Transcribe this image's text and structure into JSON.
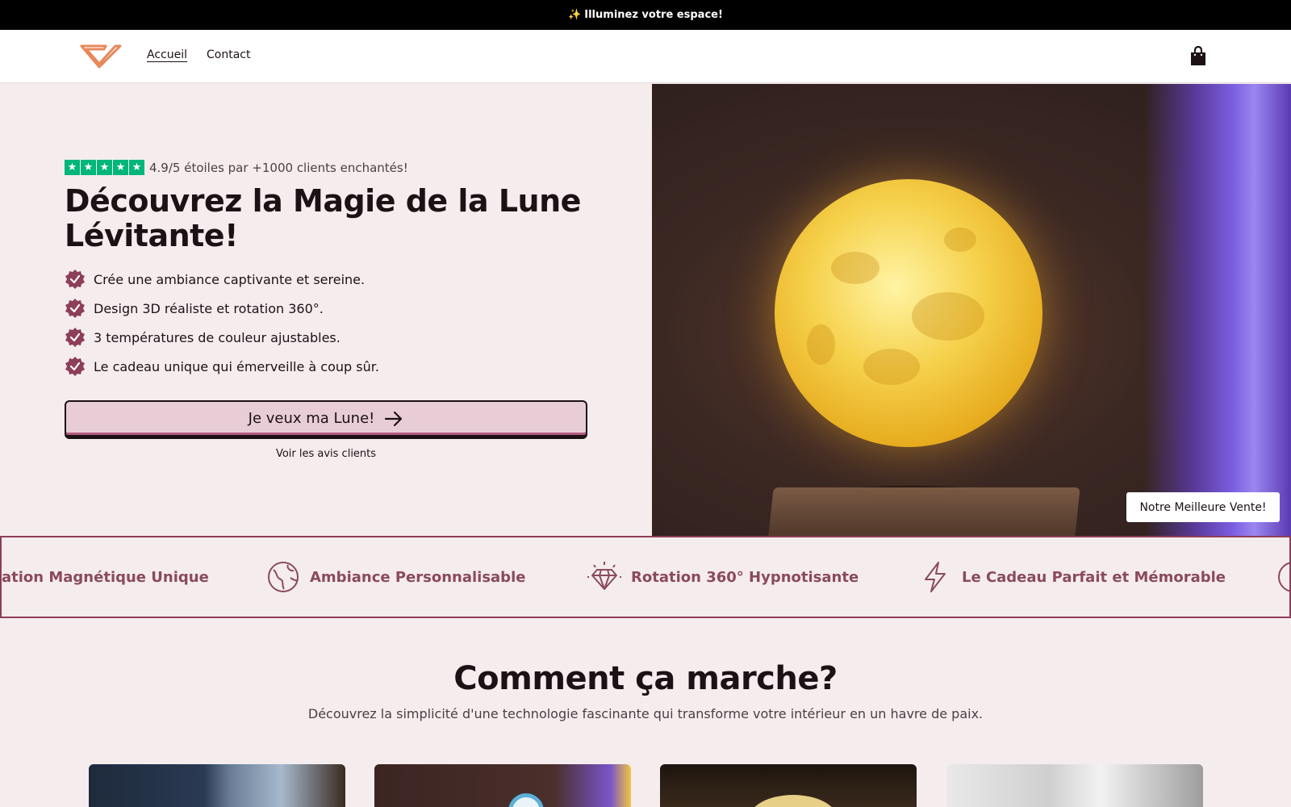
{
  "announcement": {
    "icon": "sparkles-icon",
    "text": "Illuminez votre espace!"
  },
  "header": {
    "logo": "v-logo",
    "nav": [
      {
        "label": "Accueil",
        "active": true
      },
      {
        "label": "Contact",
        "active": false
      }
    ],
    "cart_icon": "shopping-bag-icon"
  },
  "hero": {
    "rating": {
      "stars": 5,
      "text": "4.9/5 étoiles par +1000 clients enchantés!"
    },
    "title": "Découvrez la Magie de la Lune Lévitante!",
    "bullets": [
      "Crée une ambiance captivante et sereine.",
      "Design 3D réaliste et rotation 360°.",
      "3 températures de couleur ajustables.",
      "Le cadeau unique qui émerveille à coup sûr."
    ],
    "cta_label": "Je veux ma Lune!",
    "reviews_link": "Voir les avis clients",
    "badge": "Notre Meilleure Vente!"
  },
  "marquee": [
    {
      "icon": "magnet-icon",
      "label": "ation Magnétique Unique"
    },
    {
      "icon": "globe-icon",
      "label": "Ambiance Personnalisable"
    },
    {
      "icon": "diamond-icon",
      "label": "Rotation 360° Hypnotisante"
    },
    {
      "icon": "lightning-icon",
      "label": "Le Cadeau Parfait et Mémorable"
    }
  ],
  "how": {
    "title": "Comment ça marche?",
    "subtitle": "Découvrez la simplicité d'une technologie fascinante qui transforme votre intérieur en un havre de paix."
  },
  "colors": {
    "accent": "#8d3e5a",
    "trustpilot": "#00b67a",
    "cta_bg": "#e8ccd6",
    "page_bg": "#f5ecee"
  }
}
